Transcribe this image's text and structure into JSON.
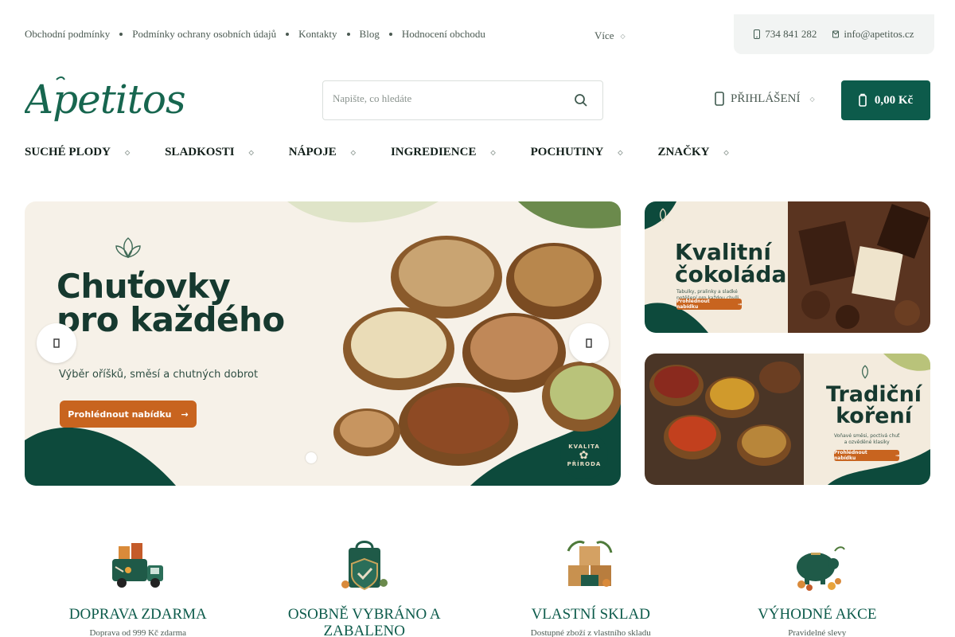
{
  "topbar": {
    "links": [
      "Obchodní podmínky",
      "Podmínky ochrany osobních údajů",
      "Kontakty",
      "Blog",
      "Hodnocení obchodu"
    ],
    "more_label": "Více",
    "phone": "734 841 282",
    "email": "info@apetitos.cz"
  },
  "header": {
    "logo_text": "Apetitos",
    "search_placeholder": "Napište, co hledáte",
    "login_label": "PŘIHLÁŠENÍ",
    "cart_total": "0,00 Kč"
  },
  "nav": {
    "items": [
      "SUCHÉ PLODY",
      "SLADKOSTI",
      "NÁPOJE",
      "INGREDIENCE",
      "POCHUTINY",
      "ZNAČKY"
    ]
  },
  "hero": {
    "title_line1": "Chuťovky",
    "title_line2": "pro každého",
    "subtitle": "Výběr oříšků, směsí a chutných dobrot",
    "cta": "Prohlédnout nabídku",
    "badge_top": "KVALITA",
    "badge_bottom": "PŘÍRODA",
    "slide_count": 1,
    "active_slide": 1
  },
  "banners": [
    {
      "title_line1": "Kvalitní",
      "title_line2": "čokoláda",
      "desc_line1": "Tabulky, pralinky a sladké",
      "desc_line2": "potěšení pro každou chvíli",
      "cta": "Prohlédnout nabídku"
    },
    {
      "title_line1": "Tradiční",
      "title_line2": "koření",
      "desc_line1": "Voňavé směsi, poctivá chuť",
      "desc_line2": "a ozvěděné klasiky",
      "cta": "Prohlédnout nabídku"
    }
  ],
  "features": [
    {
      "title": "DOPRAVA ZDARMA",
      "text": "Doprava od 999 Kč zdarma",
      "icon": "delivery-truck-icon"
    },
    {
      "title": "OSOBNĚ VYBRÁNO A ZABALENO",
      "text": "",
      "icon": "gift-bag-icon"
    },
    {
      "title": "VLASTNÍ SKLAD",
      "text": "Dostupné zboží z vlastního skladu",
      "icon": "boxes-icon"
    },
    {
      "title": "VÝHODNÉ AKCE",
      "text": "Pravidelné slevy",
      "icon": "piggy-bank-icon"
    }
  ],
  "colors": {
    "brand_green": "#0d5b4b",
    "accent_orange": "#c8641f",
    "hero_bg": "#f6f1e8"
  }
}
